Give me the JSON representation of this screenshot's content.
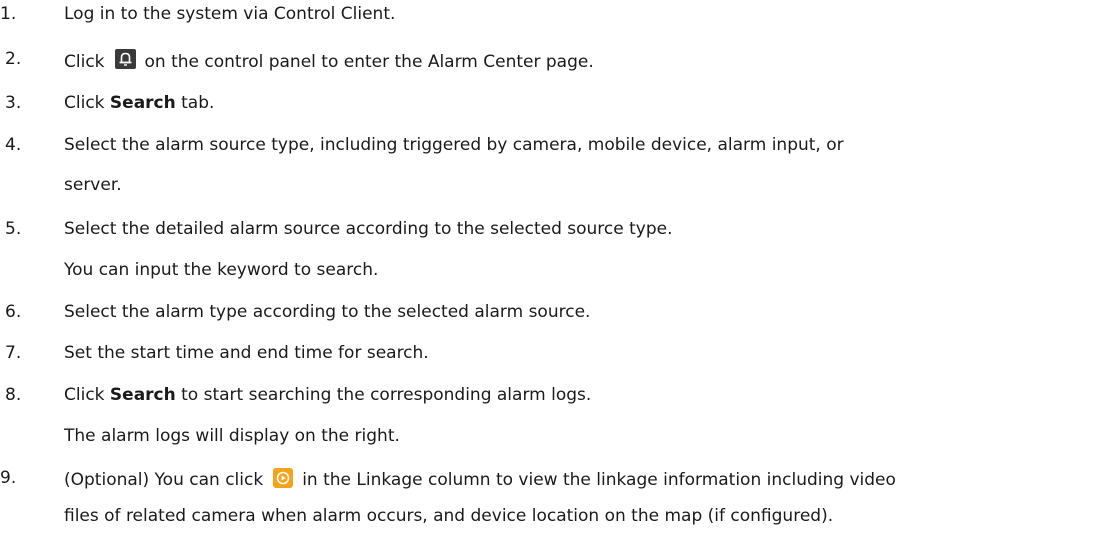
{
  "steps": [
    {
      "num": "1.",
      "text": "Log in to the system via Control Client."
    },
    {
      "num": "2.",
      "pre": "Click",
      "icon": "bell-icon",
      "post": "on the control panel to enter the Alarm Center page."
    },
    {
      "num": "3.",
      "pre": "Click ",
      "bold": "Search",
      "post": " tab."
    },
    {
      "num": "4.",
      "text": "Select the alarm source type, including triggered by camera, mobile device, alarm input, or",
      "cont": "server."
    },
    {
      "num": "5.",
      "text": "Select the detailed alarm source according to the selected source type.",
      "cont": "You can input the keyword to search."
    },
    {
      "num": "6.",
      "text": "Select the alarm type according to the selected alarm source."
    },
    {
      "num": "7.",
      "text": "Set the start time and end time for search."
    },
    {
      "num": "8.",
      "pre": "Click ",
      "bold": "Search",
      "post": " to start searching the corresponding alarm logs.",
      "cont": "The alarm logs will display on the right."
    },
    {
      "num": "9.",
      "pre": "(Optional) You can click",
      "icon": "play-icon",
      "post": "in the Linkage column to view the linkage information including video",
      "cont": "files of related camera when alarm occurs, and device location on the map (if configured)."
    }
  ],
  "icons": {
    "bell": {
      "name": "bell-icon",
      "bg": "#3a3a3a",
      "fg": "#ffffff"
    },
    "play": {
      "name": "play-icon",
      "bg": "#f5a31a",
      "fg": "#ffffff"
    }
  }
}
